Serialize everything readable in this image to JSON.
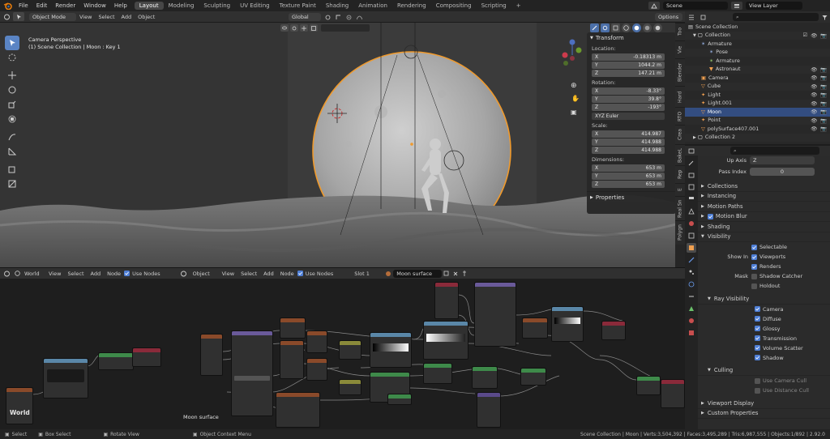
{
  "menu": [
    "File",
    "Edit",
    "Render",
    "Window",
    "Help"
  ],
  "workspaces": [
    "Layout",
    "Modeling",
    "Sculpting",
    "UV Editing",
    "Texture Paint",
    "Shading",
    "Animation",
    "Rendering",
    "Compositing",
    "Scripting"
  ],
  "active_workspace": "Layout",
  "scene_field": "Scene",
  "view_layer_field": "View Layer",
  "viewport": {
    "mode": "Object Mode",
    "menus": [
      "View",
      "Select",
      "Add",
      "Object"
    ],
    "orientation": "Global",
    "options": "Options",
    "info_line1": "Camera Perspective",
    "info_line2": "(1) Scene Collection | Moon : Key 1"
  },
  "side_tabs": [
    "Too",
    "Vie",
    "Blender",
    "Hard",
    "RTO",
    "Crea",
    "BakeL",
    "Rep",
    "E",
    "Real Sn",
    "Polygn"
  ],
  "n_panel": {
    "title": "Transform",
    "location_label": "Location:",
    "location": [
      {
        "axis": "X",
        "value": "-0.18313 m"
      },
      {
        "axis": "Y",
        "value": "1044.2 m"
      },
      {
        "axis": "Z",
        "value": "147.21 m"
      }
    ],
    "rotation_label": "Rotation:",
    "rotation": [
      {
        "axis": "X",
        "value": "-8.33°"
      },
      {
        "axis": "Y",
        "value": "39.8°"
      },
      {
        "axis": "Z",
        "value": "-193°"
      }
    ],
    "rotation_mode": "XYZ Euler",
    "scale_label": "Scale:",
    "scale": [
      {
        "axis": "X",
        "value": "414.987"
      },
      {
        "axis": "Y",
        "value": "414.988"
      },
      {
        "axis": "Z",
        "value": "414.988"
      }
    ],
    "dimensions_label": "Dimensions:",
    "dimensions": [
      {
        "axis": "X",
        "value": "653 m"
      },
      {
        "axis": "Y",
        "value": "653 m"
      },
      {
        "axis": "Z",
        "value": "653 m"
      }
    ],
    "properties_title": "Properties"
  },
  "node_editor_left": {
    "type": "World",
    "menus": [
      "View",
      "Select",
      "Add",
      "Node"
    ],
    "use_nodes": "Use Nodes",
    "label": "World"
  },
  "node_editor_right": {
    "type": "Object",
    "menus": [
      "View",
      "Select",
      "Add",
      "Node"
    ],
    "use_nodes": "Use Nodes",
    "slot": "Slot 1",
    "material": "Moon surface",
    "label": "Moon surface"
  },
  "outliner": {
    "search_placeholder": "",
    "items": [
      {
        "label": "Scene Collection",
        "indent": 0
      },
      {
        "label": "Collection",
        "indent": 1
      },
      {
        "label": "Armature",
        "indent": 2
      },
      {
        "label": "Pose",
        "indent": 3
      },
      {
        "label": "Armature",
        "indent": 3
      },
      {
        "label": "Astronaut",
        "indent": 3
      },
      {
        "label": "Camera",
        "indent": 2
      },
      {
        "label": "Cube",
        "indent": 2
      },
      {
        "label": "Light",
        "indent": 2
      },
      {
        "label": "Light.001",
        "indent": 2
      },
      {
        "label": "Moon",
        "indent": 2
      },
      {
        "label": "Point",
        "indent": 2
      },
      {
        "label": "polySurface407.001",
        "indent": 2
      },
      {
        "label": "Collection 2",
        "indent": 1
      }
    ],
    "selected_index": 10
  },
  "properties": {
    "search_placeholder": "",
    "up_axis_label": "Up Axis",
    "up_axis_value": "Z",
    "pass_index_label": "Pass Index",
    "pass_index_value": "0",
    "sections": [
      "Collections",
      "Instancing",
      "Motion Paths",
      "Motion Blur",
      "Shading",
      "Visibility"
    ],
    "selectable": "Selectable",
    "show_in_label": "Show In",
    "viewports": "Viewports",
    "renders": "Renders",
    "mask_label": "Mask",
    "shadow_catcher": "Shadow Catcher",
    "holdout": "Holdout",
    "ray_visibility": "Ray Visibility",
    "ray_items": [
      "Camera",
      "Diffuse",
      "Glossy",
      "Transmission",
      "Volume Scatter",
      "Shadow"
    ],
    "culling": "Culling",
    "use_camera_cull": "Use Camera Cull",
    "use_distance_cull": "Use Distance Cull",
    "bottom_sections": [
      "Viewport Display",
      "Custom Properties"
    ]
  },
  "status": {
    "select": "Select",
    "box_select": "Box Select",
    "rotate_view": "Rotate View",
    "context_menu": "Object Context Menu",
    "stats": "Scene Collection | Moon | Verts:3,504,392 | Faces:3,495,289 | Tris:6,987,555 | Objects:1/892 | 2.92.0"
  },
  "colors": {
    "accent": "#4f7fd6",
    "selection_orange": "#f09a2c",
    "panel": "#2b2b2b"
  }
}
